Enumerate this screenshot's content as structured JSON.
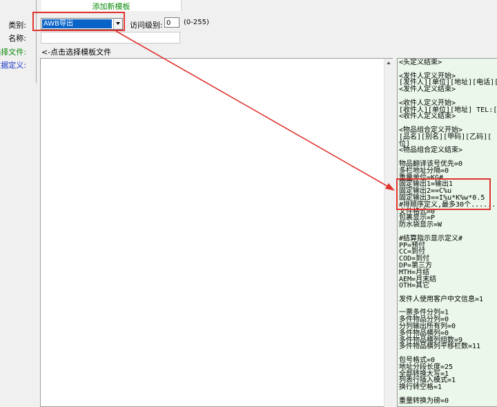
{
  "header": {
    "add_template": "添加新模板"
  },
  "form": {
    "category_label": "类别:",
    "category_value": "AWB导出",
    "access_level_label": "访问级别:",
    "access_level_value": "0",
    "access_level_range": "(0-255)",
    "name_label": "名称:",
    "select_file_label": "选择文件:",
    "select_file_hint": "<-点击选择模板文件",
    "data_def_label": "数据定义:"
  },
  "right_panel": {
    "lines": [
      "<头定义结束>",
      "",
      "<发件人定义开始>",
      "[发件人][单位][地址][电话][邮",
      "<发件人定义结束>",
      "",
      "<收件人定义开始>",
      "[收件人][单位][地址] TEL:[电",
      "<收件人定义结束>",
      "",
      "<物品组合定义开始>",
      "[品名][别名][甲码][乙码][",
      "位]",
      "<物品组合定义结束>",
      "",
      "物品翻译该号优先=0",
      "多栏地址分隔=0",
      "重量单位=KG#",
      "固定输出1=输出1",
      "固定输出2==C%u",
      "固定输出3==I%u*K%w*0.5",
      "#排顺序定义,最多30个......",
      "文件格式=0",
      "包裹显示=P",
      "防水袋显示=W",
      "",
      "#结算指示显示定义#",
      "PP=预付",
      "CC=到付",
      "COD=到付",
      "DP=第三方",
      "MTH=月结",
      "AEM=月末结",
      "OTH=其它",
      "",
      "发件人使用客户中文信息=1",
      "",
      "一票多件分列=1",
      "多件物品分列=0",
      "分列输出所有列=0",
      "多件物品横列=0",
      "多件物品横列组数=9",
      "多件物品横列平移栏数=11",
      "",
      "包号格式=0",
      "地址分段长度=25",
      "全部转换大写=1",
      "列表行插入模式=1",
      "换行转空格=1",
      "",
      "重量转换为磅=0"
    ]
  },
  "colors": {
    "highlight": "#e0332e",
    "selection": "#0a64c8",
    "editor_bg": "#eaf7ea"
  }
}
